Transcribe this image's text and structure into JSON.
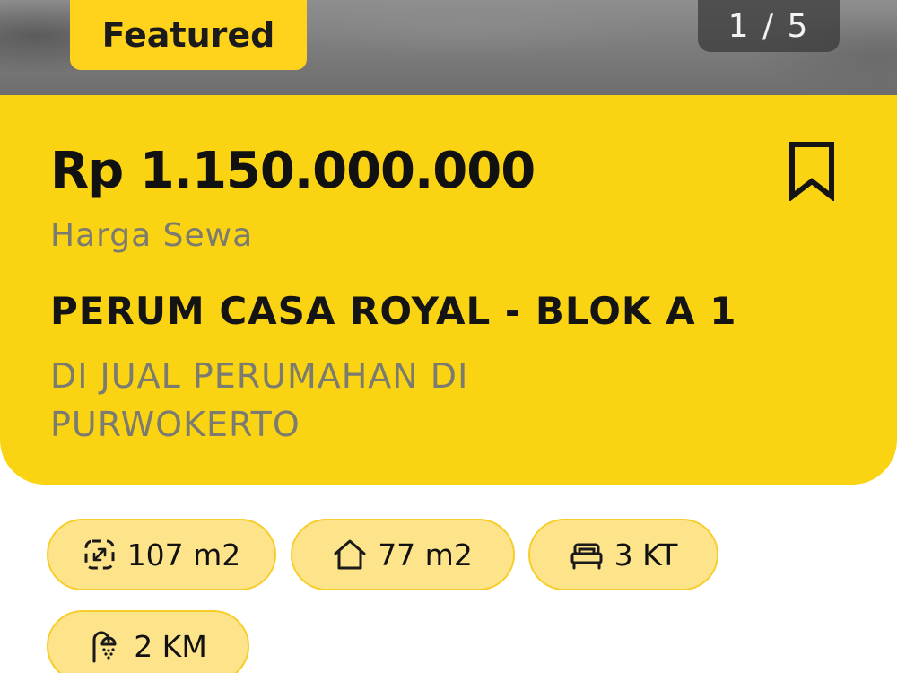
{
  "gallery": {
    "featured_label": "Featured",
    "counter": "1 / 5"
  },
  "listing": {
    "price": "Rp 1.150.000.000",
    "price_label": "Harga Sewa",
    "title": "PERUM CASA ROYAL - BLOK A 1",
    "description": "DI JUAL PERUMAHAN DI PURWOKERTO"
  },
  "features": [
    {
      "icon": "land-area-icon",
      "label": "107 m2"
    },
    {
      "icon": "house-icon",
      "label": "77 m2"
    },
    {
      "icon": "bed-icon",
      "label": "3 KT"
    },
    {
      "icon": "shower-icon",
      "label": "2 KM"
    }
  ],
  "colors": {
    "card_yellow": "#fad312",
    "chip_fill": "#fde38a",
    "chip_border": "#f7cd2a",
    "muted_text": "#7c7b70"
  }
}
